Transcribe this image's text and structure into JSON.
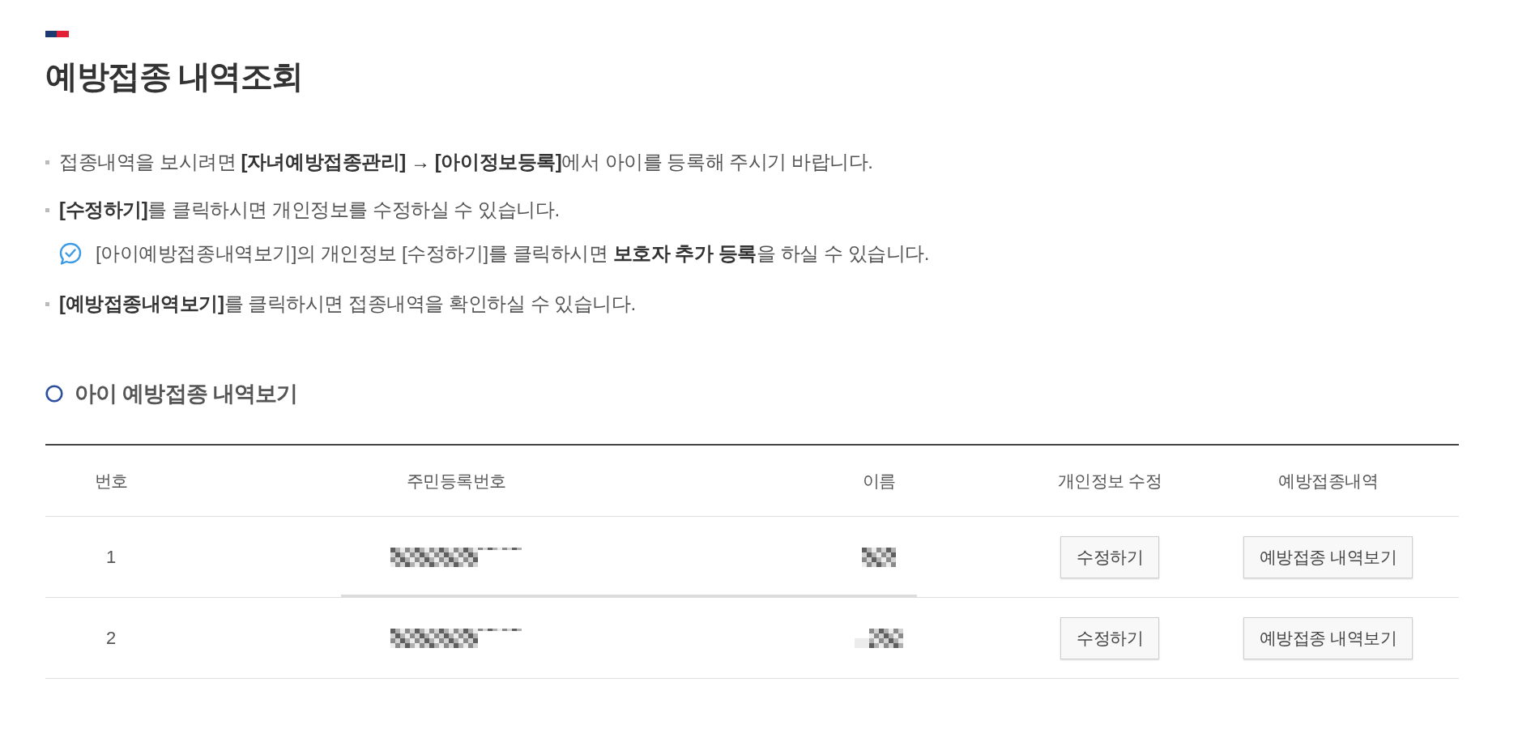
{
  "title_bar": {
    "title": "예방접종 내역조회"
  },
  "notices": [
    {
      "kind": "bullet",
      "text": "접종내역을 보시려면 **[자녀예방접종관리] → [아이정보등록]**에서 아이를 등록해 주시기 바랍니다."
    },
    {
      "kind": "bullet",
      "text": "**[수정하기]**를 클릭하시면 개인정보를 수정하실 수 있습니다."
    },
    {
      "kind": "note",
      "text": "[아이예방접종내역보기]의 개인정보 [수정하기]를 클릭하시면 **보호자 추가 등록**을 하실 수 있습니다."
    },
    {
      "kind": "bullet",
      "text": "**[예방접종내역보기]**를 클릭하시면 접종내역을 확인하실 수 있습니다."
    }
  ],
  "section": {
    "title": "아이 예방접종 내역보기"
  },
  "table": {
    "columns": [
      "번호",
      "주민등록번호",
      "이름",
      "개인정보 수정",
      "예방접종내역"
    ],
    "rows": [
      {
        "number": "1",
        "edit_button": "수정하기",
        "history_button": "예방접종 내역보기"
      },
      {
        "number": "2",
        "edit_button": "수정하기",
        "history_button": "예방접종 내역보기"
      }
    ]
  }
}
